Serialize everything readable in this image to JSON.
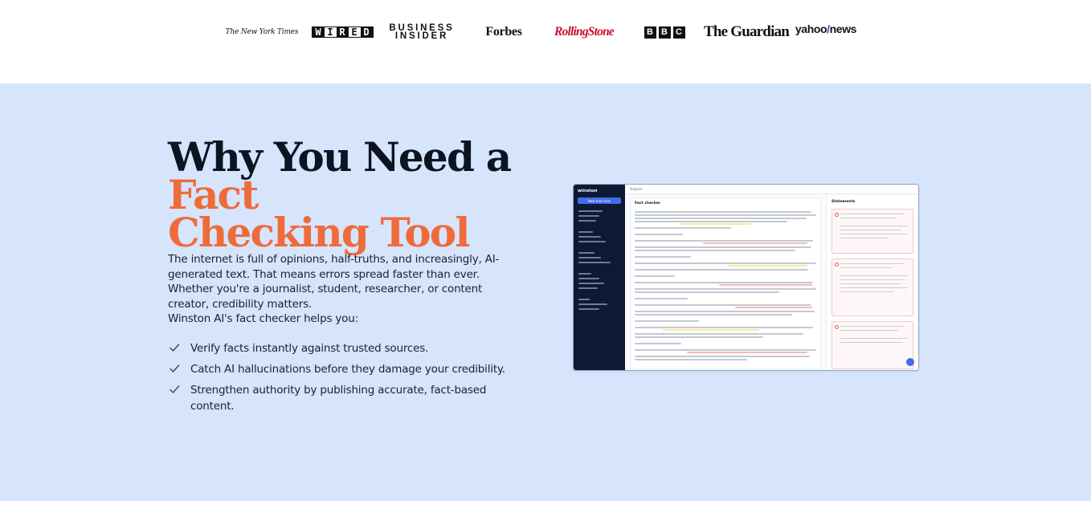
{
  "logos": {
    "nyt": "The New York Times",
    "wired": [
      "W",
      "I",
      "R",
      "E",
      "D"
    ],
    "business_insider_line1": "BUSINESS",
    "business_insider_line2": "INSIDER",
    "forbes": "Forbes",
    "rolling_stone": "RollingStone",
    "bbc": [
      "B",
      "B",
      "C"
    ],
    "guardian": "The Guardian",
    "yahoo_part1": "yahoo",
    "yahoo_slash": "/",
    "yahoo_part2": "news"
  },
  "hero": {
    "headline_plain": "Why You Need a",
    "headline_accent_1": "Fact",
    "headline_accent_2": "Checking Tool",
    "description": "The internet is full of opinions, half-truths, and increasingly, AI-generated text. That means errors spread faster than ever. Whether you're a journalist, student, researcher, or content creator, credibility matters.",
    "helps_intro": "Winston AI's fact checker helps you:",
    "benefits": [
      "Verify facts instantly against trusted sources.",
      "Catch AI hallucinations before they damage your credibility.",
      "Strengthen authority by publishing accurate, fact-based content."
    ]
  },
  "mockup": {
    "logo": "winston",
    "new_scan": "New text scan",
    "breadcrumb": "Projects",
    "title": "Fact checker",
    "panel_title": "Statements"
  },
  "colors": {
    "hero_bg": "#d6e4fc",
    "accent": "#ef6b3a",
    "heading": "#0c1321",
    "check": "#3a4663"
  }
}
